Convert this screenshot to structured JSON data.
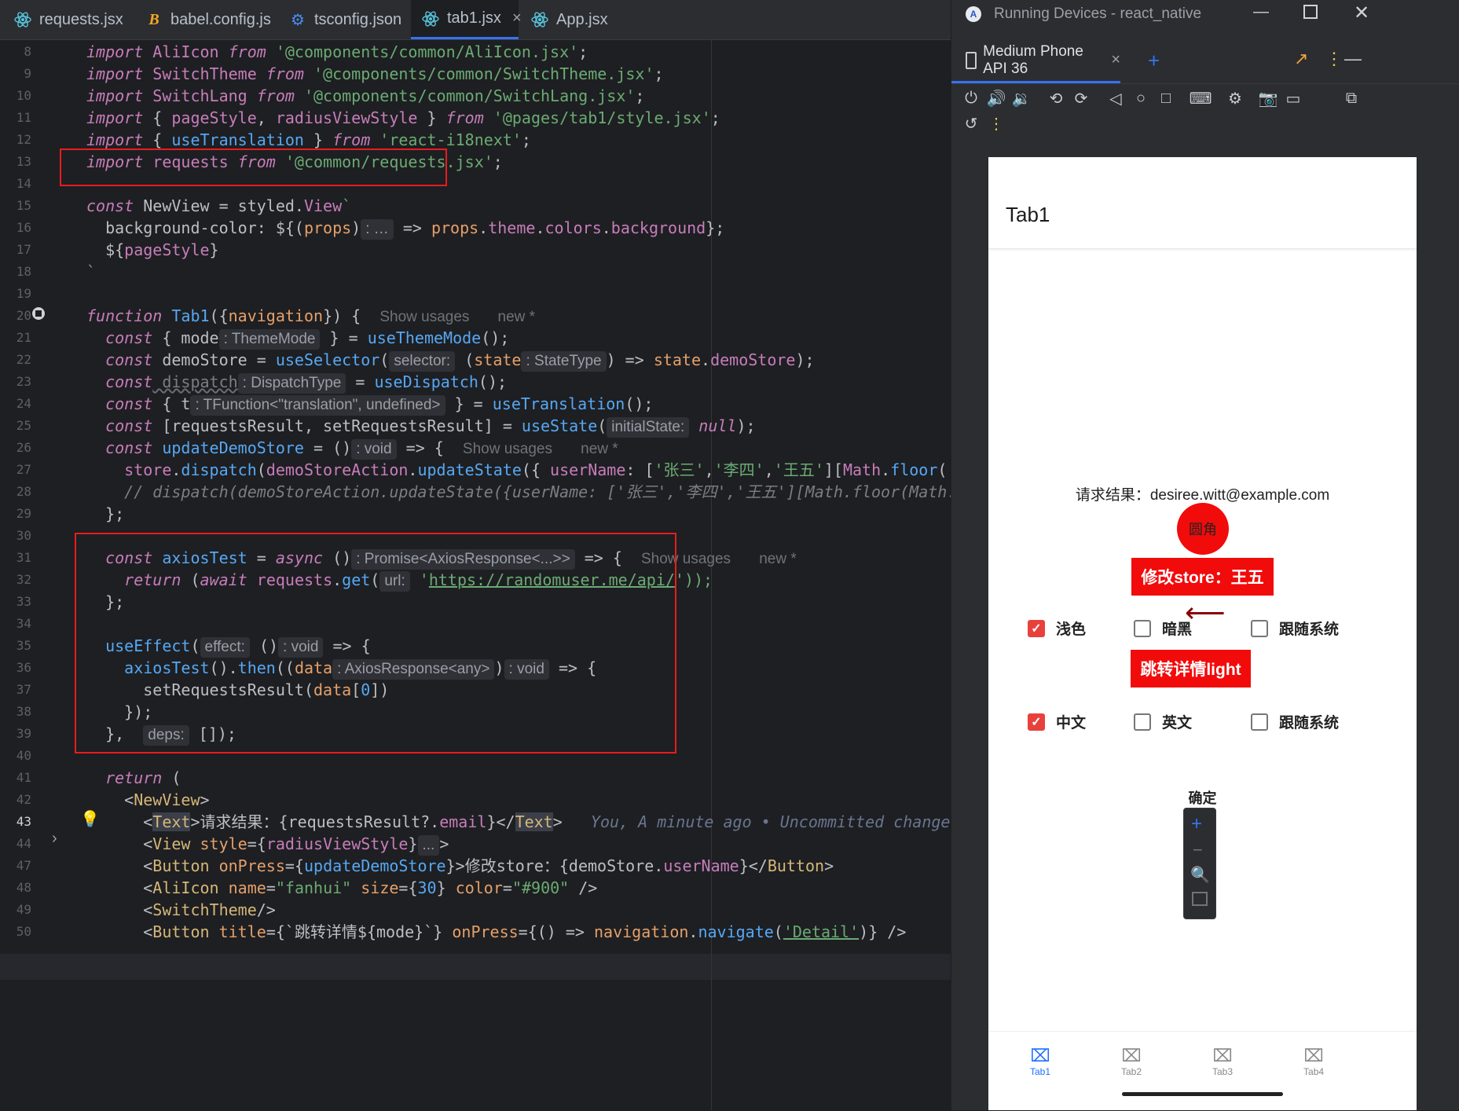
{
  "editor": {
    "tabs": [
      {
        "label": "requests.jsx",
        "icon": "react-icon"
      },
      {
        "label": "babel.config.js",
        "icon": "babel-icon"
      },
      {
        "label": "tsconfig.json",
        "icon": "gear-icon"
      },
      {
        "label": "tab1.jsx",
        "icon": "react-icon",
        "active": true
      },
      {
        "label": "App.jsx",
        "icon": "react-icon"
      }
    ],
    "line_numbers": [
      "8",
      "9",
      "10",
      "11",
      "12",
      "13",
      "14",
      "15",
      "16",
      "17",
      "18",
      "19",
      "20",
      "21",
      "22",
      "23",
      "24",
      "25",
      "26",
      "27",
      "28",
      "29",
      "30",
      "31",
      "32",
      "33",
      "34",
      "35",
      "36",
      "37",
      "38",
      "39",
      "40",
      "41",
      "42",
      "43",
      "44",
      "47",
      "48",
      "49",
      "50"
    ],
    "lines": {
      "l8": [
        "import",
        " AliIcon ",
        "from",
        " '@components/common/AliIcon.jsx'",
        ";"
      ],
      "l9": [
        "import",
        " SwitchTheme ",
        "from",
        " '@components/common/SwitchTheme.jsx'",
        ";"
      ],
      "l10": [
        "import",
        " SwitchLang ",
        "from",
        " '@components/common/SwitchLang.jsx'",
        ";"
      ],
      "l11": [
        "import",
        " { ",
        "pageStyle",
        ", ",
        "radiusViewStyle",
        " } ",
        "from",
        " '@pages/tab1/style.jsx'",
        ";"
      ],
      "l12": [
        "import",
        " { ",
        "useTranslation",
        " } ",
        "from",
        " 'react-i18next'",
        ";"
      ],
      "l13": [
        "import",
        " requests ",
        "from",
        " '@common/requests.jsx'",
        ";"
      ],
      "l15": [
        "const",
        " NewView = styled.",
        "View",
        "`"
      ],
      "l16": [
        "  background-color: ${(",
        "props",
        ")",
        ": …",
        " => ",
        "props",
        ".",
        "theme",
        ".",
        "colors",
        ".",
        "background",
        "};"
      ],
      "l17": [
        "  ${",
        "pageStyle",
        "}"
      ],
      "l18": [
        "`"
      ],
      "l20": [
        "function",
        " ",
        "Tab1",
        "({",
        "navigation",
        "}) {",
        "Show usages",
        "new *"
      ],
      "l21": [
        "  const",
        " { mode",
        ": ThemeMode",
        " } = ",
        "useThemeMode",
        "();"
      ],
      "l22": [
        "  const",
        " demoStore = ",
        "useSelector",
        "(",
        "selector:",
        " (",
        "state",
        ": StateType",
        ") => ",
        "state",
        ".",
        "demoStore",
        ");"
      ],
      "l23": [
        "  const",
        " dispatch",
        ": DispatchType",
        " = ",
        "useDispatch",
        "();"
      ],
      "l24": [
        "  const",
        " { t",
        ": TFunction<\"translation\", undefined>",
        " } = ",
        "useTranslation",
        "();"
      ],
      "l25": [
        "  const",
        " [requestsResult, setRequestsResult] = ",
        "useState",
        "(",
        "initialState:",
        " null",
        ");"
      ],
      "l26": [
        "  const",
        " ",
        "updateDemoStore",
        " = ()",
        ": void",
        " => {",
        "Show usages",
        "new *"
      ],
      "l27": [
        "    store",
        ".",
        "dispatch",
        "(",
        "demoStoreAction",
        ".",
        "updateState",
        "({ ",
        "userName",
        ": [",
        "'张三'",
        ",",
        "'李四'",
        ",",
        "'王五'",
        "][",
        "Math",
        ".",
        "floor",
        "("
      ],
      "l28": [
        "    // dispatch(demoStoreAction.updateState({userName: ['张三','李四','王五'][Math.floor(Math."
      ],
      "l29": [
        "  };"
      ],
      "l31": [
        "  const",
        " ",
        "axiosTest",
        " = ",
        "async",
        " ()",
        ": Promise<AxiosResponse<...>>",
        " => {",
        "Show usages",
        "new *"
      ],
      "l32": [
        "    return",
        " (",
        "await",
        " ",
        "requests",
        ".",
        "get",
        "(",
        "url:",
        " '",
        "https://randomuser.me/api/",
        "'));"
      ],
      "l33": [
        "  };"
      ],
      "l35": [
        "  ",
        "useEffect",
        "(",
        "effect:",
        " ()",
        ": void",
        " => {"
      ],
      "l36": [
        "    ",
        "axiosTest",
        "().",
        "then",
        "((",
        "data",
        ": AxiosResponse<any>",
        ")",
        ": void",
        " => {"
      ],
      "l37": [
        "      setRequestsResult(",
        "data",
        "[",
        "0",
        "])"
      ],
      "l38": [
        "    });"
      ],
      "l39": [
        "  },",
        "deps:",
        " []);"
      ],
      "l41": [
        "  return",
        " ("
      ],
      "l42": [
        "    <",
        "NewView",
        ">"
      ],
      "l43": [
        "      <",
        "Text",
        ">请求结果：{requestsResult?.",
        "email",
        "}</",
        "Text",
        ">",
        "You, A minute ago • Uncommitted changes"
      ],
      "l44": [
        "      <",
        "View",
        " ",
        "style",
        "={",
        "radiusViewStyle",
        "}",
        "...",
        ">"
      ],
      "l47": [
        "      <",
        "Button",
        " ",
        "onPress",
        "={",
        "updateDemoStore",
        "}>修改store：{demoStore.",
        "userName",
        "}</",
        "Button",
        ">"
      ],
      "l48": [
        "      <",
        "AliIcon",
        " ",
        "name",
        "=",
        "\"fanhui\"",
        " ",
        "size",
        "={",
        "30",
        "} ",
        "color",
        "=",
        "\"#900\"",
        " />"
      ],
      "l49": [
        "      <",
        "SwitchTheme",
        "/>"
      ],
      "l50": [
        "      <",
        "Button",
        " ",
        "title",
        "={`跳转详情${mode}`} ",
        "onPress",
        "={() => ",
        "navigation",
        ".",
        "navigate",
        "(",
        "'Detail'",
        ")} />"
      ]
    }
  },
  "emulator": {
    "title": "Running Devices - react_native",
    "device_tab": "Medium Phone API 36",
    "app": {
      "title": "Tab1",
      "result_text": "请求结果：desiree.witt@example.com",
      "circle_label": "圆角",
      "store_button": "修改store：王五",
      "theme_options": [
        "浅色",
        "暗黑",
        "跟随系统"
      ],
      "theme_checked": 0,
      "detail_button": "跳转详情light",
      "lang_options": [
        "中文",
        "英文",
        "跟随系统"
      ],
      "lang_checked": 0,
      "confirm": "确定",
      "tabs": [
        "Tab1",
        "Tab2",
        "Tab3",
        "Tab4"
      ],
      "active_tab": 0
    }
  },
  "colors": {
    "accent_red": "#f20b0b",
    "tab_active": "#1e6fff",
    "annotation": "#e81c1c"
  }
}
